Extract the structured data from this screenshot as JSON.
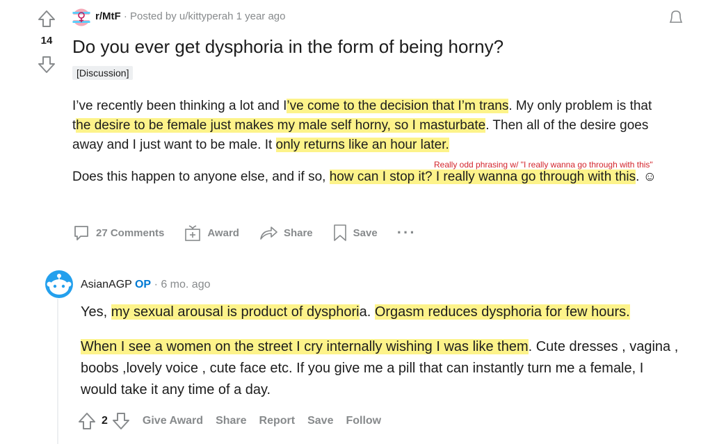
{
  "post": {
    "subreddit": "r/MtF",
    "posted_by": "· Posted by u/kittyperah 1 year ago",
    "vote_count": "14",
    "title": "Do you ever get dysphoria in the form of being horny?",
    "flair": "[Discussion]",
    "paragraph1": [
      {
        "text": "I’ve recently been thinking a lot and I",
        "hl": false
      },
      {
        "text": "’ve come to the decision that I’m trans",
        "hl": true
      },
      {
        "text": ". My only problem is that t",
        "hl": false
      },
      {
        "text": "he desire to be female just makes my male self horny, so I masturbate",
        "hl": true
      },
      {
        "text": ". Then all of the desire goes away and I just want to be male. It ",
        "hl": false
      },
      {
        "text": "only returns like an hour later. ",
        "hl": true
      }
    ],
    "paragraph2": [
      {
        "text": "Does this happen to anyone else, and if so, ",
        "hl": false
      },
      {
        "text": "how can I stop it? I really wanna go through with this",
        "hl": true
      },
      {
        "text": ". ☺",
        "hl": false
      }
    ],
    "annotation": "Really odd phrasing w/ \"I really wanna go through with this\"",
    "actions": {
      "comments": "27 Comments",
      "award": "Award",
      "share": "Share",
      "save": "Save",
      "more": "···"
    }
  },
  "comment": {
    "author": "AsianAGP",
    "op_badge": "OP",
    "time": "· 6 mo. ago",
    "paragraph1": [
      {
        "text": "Yes, ",
        "hl": false
      },
      {
        "text": "my sexual arousal is product of dysphori",
        "hl": true
      },
      {
        "text": "a. ",
        "hl": false
      },
      {
        "text": "Orgasm reduces dysphoria for few hours. ",
        "hl": true
      }
    ],
    "paragraph2": [
      {
        "text": "When I see a women on the street I cry internally wishing I was like them",
        "hl": true
      },
      {
        "text": ". Cute dresses , vagina , boobs ,lovely voice , cute face etc. If you give me a pill that can instantly turn me a female, I would take it any time of a day.",
        "hl": false
      }
    ],
    "vote_count": "2",
    "actions": {
      "give_award": "Give Award",
      "share": "Share",
      "report": "Report",
      "save": "Save",
      "follow": "Follow"
    }
  },
  "colors": {
    "highlight": "#fdf38a",
    "meta_gray": "#878a8c",
    "op_blue": "#0079d3",
    "annotation_red": "#d3242b"
  }
}
